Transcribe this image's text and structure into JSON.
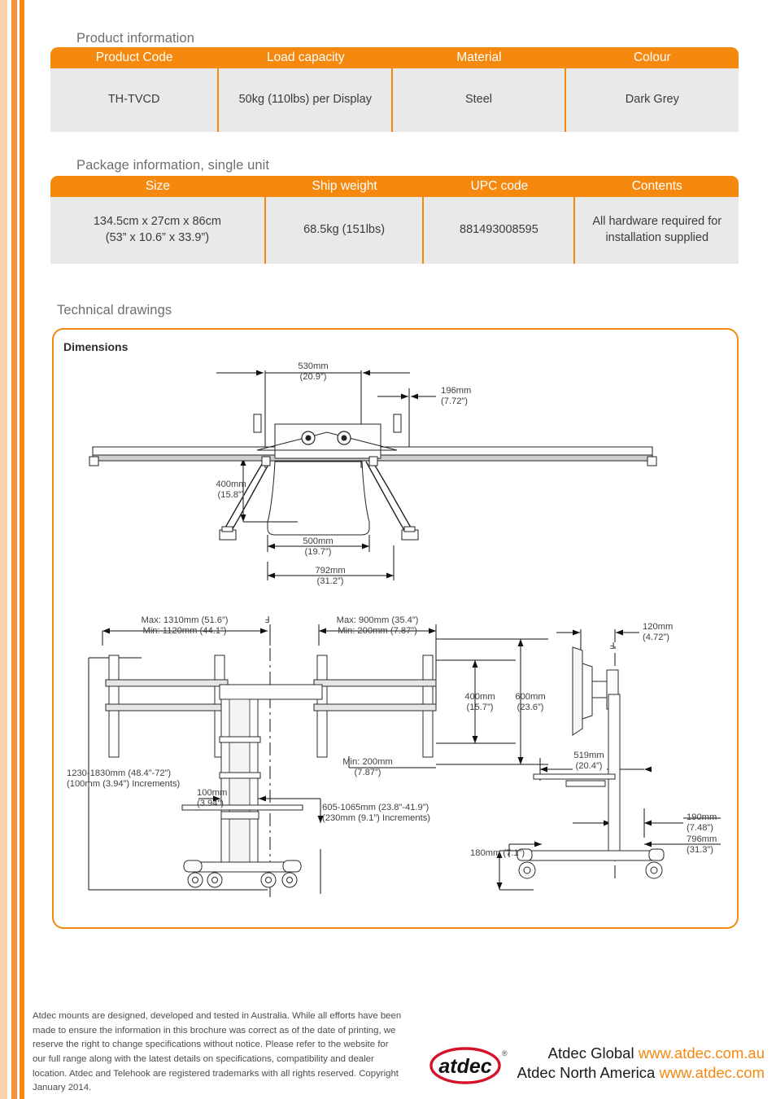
{
  "brand": {
    "accent": "#f5880e",
    "logo_text": "atdec",
    "logo_mark": "registered-trademark"
  },
  "sections": {
    "product_information_title": "Product information",
    "package_information_title": "Package information, single unit",
    "technical_drawings_title": "Technical drawings",
    "dimensions_label": "Dimensions"
  },
  "product_table": {
    "headers": [
      "Product Code",
      "Load capacity",
      "Material",
      "Colour"
    ],
    "rows": [
      [
        "TH-TVCD",
        "50kg (110lbs) per Display",
        "Steel",
        "Dark Grey"
      ]
    ]
  },
  "package_table": {
    "headers": [
      "Size",
      "Ship weight",
      "UPC code",
      "Contents"
    ],
    "rows": [
      [
        "134.5cm x 27cm x 86cm\n(53” x 10.6” x 33.9”)",
        "68.5kg (151lbs)",
        "881493008595",
        "All hardware required for\ninstallation supplied"
      ]
    ]
  },
  "drawings": {
    "top_view": {
      "d_530": "530mm",
      "d_530_in": "(20.9”)",
      "d_196": "196mm",
      "d_196_in": "(7.72”)",
      "d_400": "400mm",
      "d_400_in": "(15.8”)",
      "d_500": "500mm",
      "d_500_in": "(19.7”)",
      "d_792": "792mm",
      "d_792_in": "(31.2”)"
    },
    "front_view": {
      "width_max": "Max: 1310mm (51.6”)",
      "width_min": "Min: 1120mm (44.1”)",
      "gap_max": "Max: 900mm (35.4”)",
      "gap_min": "Min: 200mm (7.87”)",
      "height_range": "1230-1830mm (48.4”-72”)",
      "height_increments": "(100mm (3.94”) Increments)",
      "column_width": "100mm",
      "column_width_in": "(3.94”)",
      "shelf_range": "605-1065mm (23.8”-41.9”)",
      "shelf_increments": "(230mm (9.1”) Increments)",
      "min_200": "Min: 200mm",
      "min_200_in": "(7.87”)",
      "v_400": "400mm",
      "v_400_in": "(15.7”)",
      "v_600": "600mm",
      "v_600_in": "(23.6”)",
      "centerline_symbol": "centerline"
    },
    "side_view": {
      "d_120": "120mm",
      "d_120_in": "(4.72”)",
      "d_519": "519mm",
      "d_519_in": "(20.4”)",
      "d_190": "190mm",
      "d_190_in": "(7.48”)",
      "d_796": "796mm",
      "d_796_in": "(31.3”)",
      "d_180": "180mm (7.1”)"
    }
  },
  "footer": {
    "disclaimer": "Atdec mounts are designed, developed and tested in Australia. While all efforts have been made to ensure the information in this brochure was correct as of the date of printing, we reserve the right to change specifications without notice. Please refer to the website for our full range along with the latest details on specifications, compatibility and dealer location. Atdec and Telehook are registered trademarks with all rights reserved. Copyright January 2014.",
    "contacts": [
      {
        "region": "Atdec Global",
        "url": "www.atdec.com.au"
      },
      {
        "region": "Atdec North America",
        "url": "www.atdec.com"
      }
    ]
  }
}
